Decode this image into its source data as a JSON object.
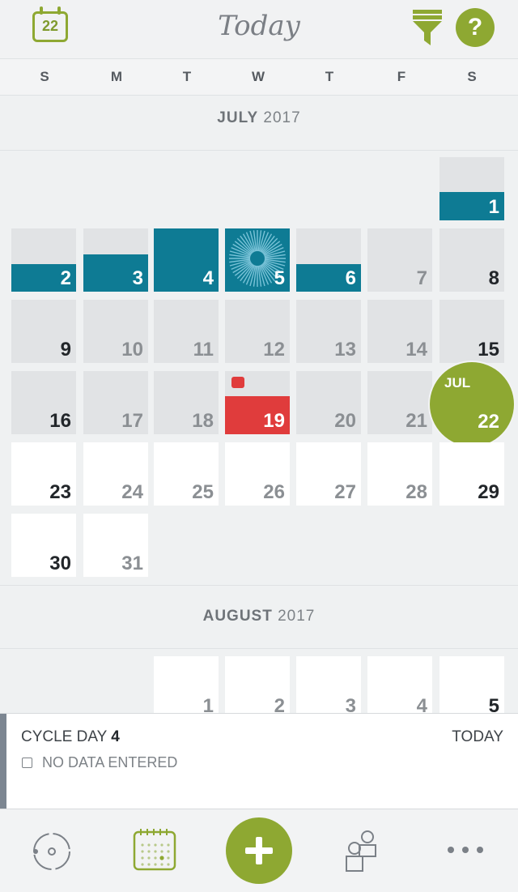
{
  "header": {
    "calendar_date": "22",
    "title": "Today",
    "help_label": "?",
    "filter_icon": "filter-icon"
  },
  "weekdays": [
    "S",
    "M",
    "T",
    "W",
    "T",
    "F",
    "S"
  ],
  "months": [
    {
      "name": "JULY",
      "year": "2017"
    },
    {
      "name": "AUGUST",
      "year": "2017"
    }
  ],
  "july_days": [
    "1",
    "2",
    "3",
    "4",
    "5",
    "6",
    "7",
    "8",
    "9",
    "10",
    "11",
    "12",
    "13",
    "14",
    "15",
    "16",
    "17",
    "18",
    "19",
    "20",
    "21",
    "22",
    "23",
    "24",
    "25",
    "26",
    "27",
    "28",
    "29",
    "30",
    "31"
  ],
  "august_days": [
    "1",
    "2",
    "3",
    "4",
    "5"
  ],
  "today_badge": {
    "month": "JUL",
    "day": "22"
  },
  "panel": {
    "cycle_label": "CYCLE DAY",
    "cycle_day": "4",
    "today_label": "TODAY",
    "no_data": "NO DATA ENTERED"
  },
  "nav": [
    "cycle-icon",
    "calendar-icon",
    "add-icon",
    "community-icon",
    "more-icon"
  ],
  "colors": {
    "accent": "#8ea832",
    "period": "#0e7b94",
    "alert": "#e03c3c"
  }
}
